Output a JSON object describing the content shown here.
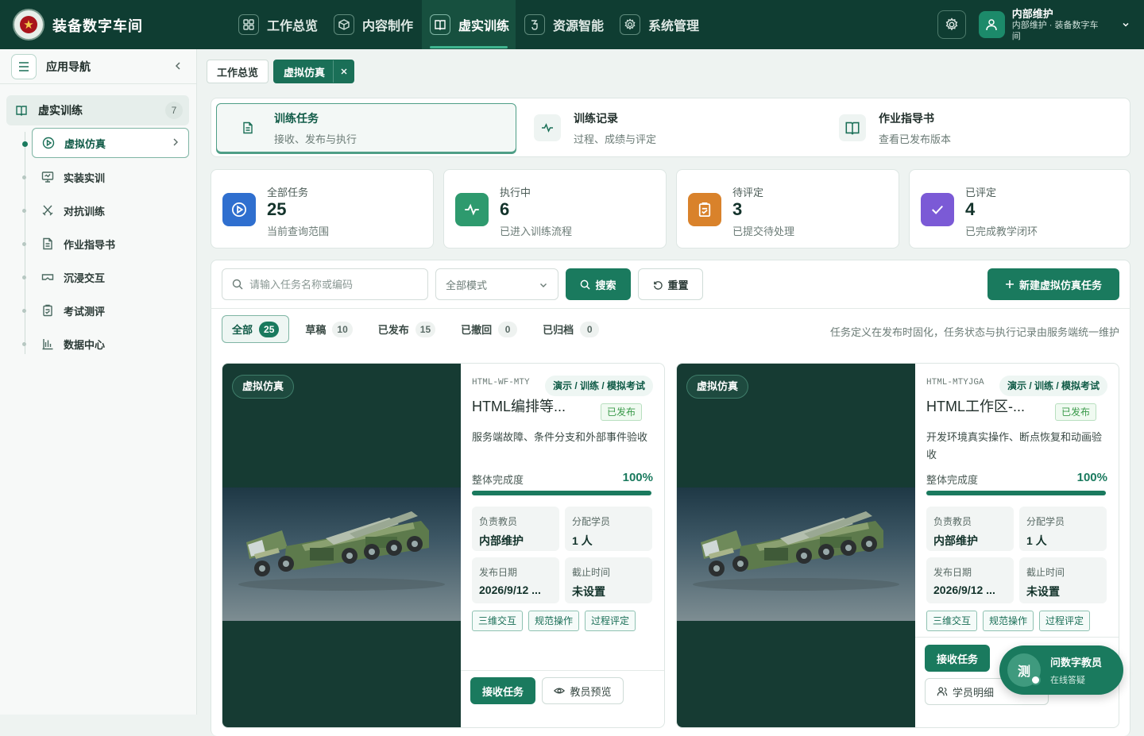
{
  "app": {
    "title": "装备数字车间",
    "logo_glyph": "★"
  },
  "nav": [
    {
      "label": "工作总览",
      "icon": "grid-icon"
    },
    {
      "label": "内容制作",
      "icon": "cube-icon"
    },
    {
      "label": "虚实训练",
      "icon": "book-icon",
      "active": true
    },
    {
      "label": "资源智能",
      "icon": "hook-icon"
    },
    {
      "label": "系统管理",
      "icon": "gear-icon"
    }
  ],
  "user": {
    "name": "内部维护",
    "sub": "内部维护 · 装备数字车间"
  },
  "sidebar": {
    "title": "应用导航",
    "group": {
      "label": "虚实训练",
      "count": "7"
    },
    "items": [
      {
        "label": "虚拟仿真",
        "icon": "play-circle-icon",
        "active": true
      },
      {
        "label": "实装实训",
        "icon": "monitor-icon"
      },
      {
        "label": "对抗训练",
        "icon": "swords-icon"
      },
      {
        "label": "作业指导书",
        "icon": "document-icon"
      },
      {
        "label": "沉浸交互",
        "icon": "vr-goggles-icon"
      },
      {
        "label": "考试测评",
        "icon": "clipboard-icon"
      },
      {
        "label": "数据中心",
        "icon": "chart-icon"
      }
    ]
  },
  "tabs": [
    {
      "label": "工作总览"
    },
    {
      "label": "虚拟仿真",
      "active": true
    }
  ],
  "modules": [
    {
      "title": "训练任务",
      "sub": "接收、发布与执行",
      "active": true
    },
    {
      "title": "训练记录",
      "sub": "过程、成绩与评定"
    },
    {
      "title": "作业指导书",
      "sub": "查看已发布版本"
    }
  ],
  "stats": [
    {
      "title": "全部任务",
      "value": "25",
      "sub": "当前查询范围",
      "color": "#2f6fcf"
    },
    {
      "title": "执行中",
      "value": "6",
      "sub": "已进入训练流程",
      "color": "#2e9a6e"
    },
    {
      "title": "待评定",
      "value": "3",
      "sub": "已提交待处理",
      "color": "#d9822b"
    },
    {
      "title": "已评定",
      "value": "4",
      "sub": "已完成教学闭环",
      "color": "#7b5ad6"
    }
  ],
  "toolbar": {
    "search_placeholder": "请输入任务名称或编码",
    "mode_select": "全部模式",
    "search_btn": "搜索",
    "reset_btn": "重置",
    "new_btn": "新建虚拟仿真任务"
  },
  "filters": [
    {
      "label": "全部",
      "count": "25",
      "active": true
    },
    {
      "label": "草稿",
      "count": "10"
    },
    {
      "label": "已发布",
      "count": "15"
    },
    {
      "label": "已撤回",
      "count": "0"
    },
    {
      "label": "已归档",
      "count": "0"
    }
  ],
  "filter_note": "任务定义在发布时固化，任务状态与执行记录由服务端统一维护",
  "tasks": [
    {
      "tag": "虚拟仿真",
      "code": "HTML-WF-MTY",
      "mode": "演示 / 训练 / 模拟考试",
      "name": "HTML编排等...",
      "status": "已发布",
      "desc": "服务端故障、条件分支和外部事件验收",
      "progress_label": "整体完成度",
      "progress_text": "100%",
      "progress": 1.0,
      "teacher_k": "负责教员",
      "teacher_v": "内部维护",
      "students_k": "分配学员",
      "students_v": "1 人",
      "pub_k": "发布日期",
      "pub_v": "2026/9/12 ...",
      "due_k": "截止时间",
      "due_v": "未设置",
      "chips": [
        "三维交互",
        "规范操作",
        "过程评定"
      ],
      "btn_receive": "接收任务",
      "btn_preview": "教员预览"
    },
    {
      "tag": "虚拟仿真",
      "code": "HTML-MTYJGA",
      "mode": "演示 / 训练 / 模拟考试",
      "name": "HTML工作区-...",
      "status": "已发布",
      "desc": "开发环境真实操作、断点恢复和动画验收",
      "progress_label": "整体完成度",
      "progress_text": "100%",
      "progress": 1.0,
      "teacher_k": "负责教员",
      "teacher_v": "内部维护",
      "students_k": "分配学员",
      "students_v": "1 人",
      "pub_k": "发布日期",
      "pub_v": "2026/9/12 ...",
      "due_k": "截止时间",
      "due_v": "未设置",
      "chips": [
        "三维交互",
        "规范操作",
        "过程评定"
      ],
      "btn_receive": "接收任务",
      "btn_students": "学员明细"
    }
  ],
  "assistant": {
    "avatar": "测",
    "title": "问数字教员",
    "sub": "在线答疑"
  }
}
